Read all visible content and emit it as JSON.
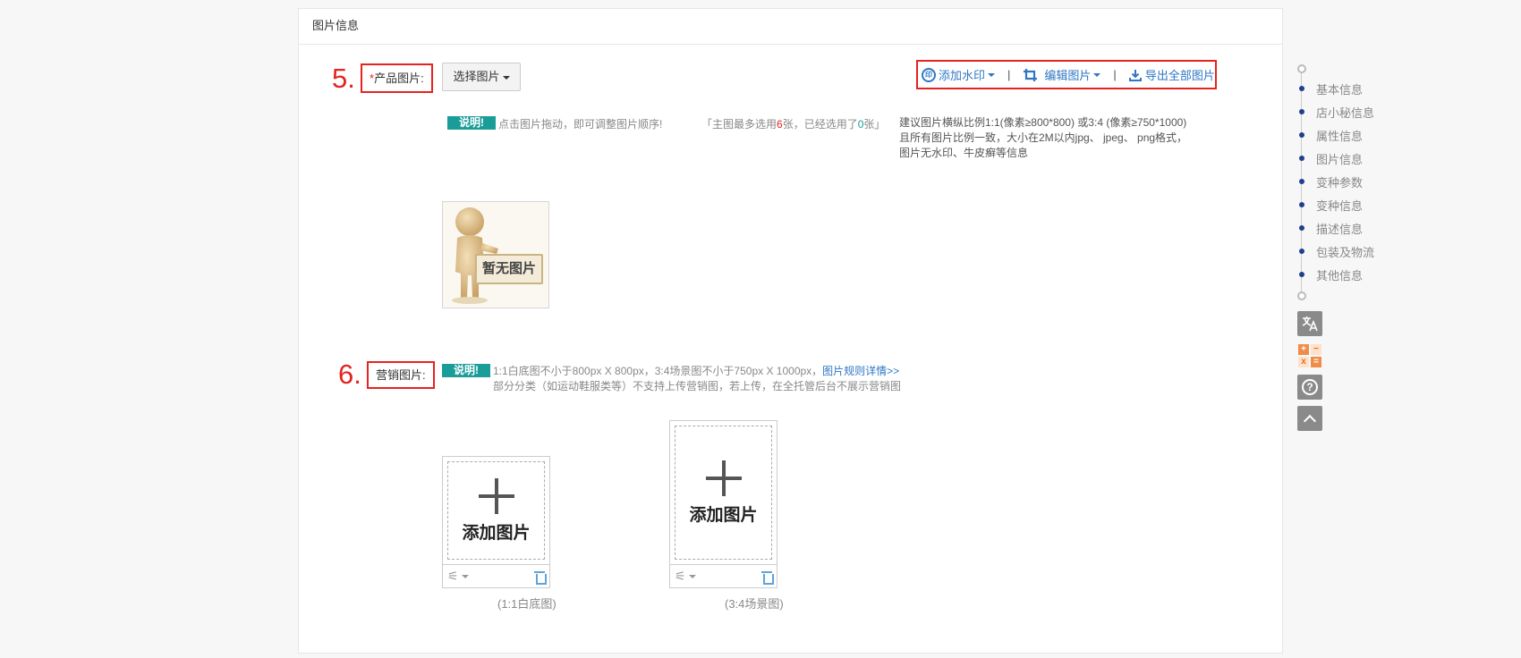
{
  "panel": {
    "title": "图片信息"
  },
  "product_images": {
    "step": "5.",
    "required_mark": "*",
    "label": "产品图片:",
    "select_button": "选择图片",
    "toolbar": {
      "watermark_icon": "印",
      "watermark": "添加水印",
      "edit": "编辑图片",
      "export": "导出全部图片",
      "separator": "|"
    },
    "note": {
      "badge": "说明!",
      "drag_hint": "点击图片拖动，即可调整图片顺序!",
      "count_prefix": "「主图最多选用",
      "max_count": "6",
      "count_middle": "张，已经选用了",
      "used_count": "0",
      "count_suffix": "张」",
      "spec_line1": "建议图片横纵比例1:1(像素≥800*800) 或3:4 (像素≥750*1000)",
      "spec_line2": "且所有图片比例一致，大小在2M以内jpg、 jpeg、 png格式，",
      "spec_line3": "图片无水印、牛皮癣等信息"
    },
    "placeholder_caption": "暂无图片"
  },
  "marketing_images": {
    "step": "6.",
    "label": "营销图片:",
    "note": {
      "badge": "说明!",
      "line1": "1:1白底图不小于800px X 800px，3:4场景图不小于750px X 1000px，",
      "rules_link": "图片规则详情>>",
      "line2": "部分分类（如运动鞋服类等）不支持上传营销图，若上传，在全托管后台不展示营销图"
    },
    "slots": [
      {
        "label": "添加图片",
        "caption": "(1:1白底图)"
      },
      {
        "label": "添加图片",
        "caption": "(3:4场景图)"
      }
    ]
  },
  "nav": {
    "items": [
      {
        "label": "基本信息"
      },
      {
        "label": "店小秘信息"
      },
      {
        "label": "属性信息"
      },
      {
        "label": "图片信息"
      },
      {
        "label": "变种参数"
      },
      {
        "label": "变种信息"
      },
      {
        "label": "描述信息"
      },
      {
        "label": "包装及物流"
      },
      {
        "label": "其他信息"
      }
    ]
  },
  "side_tools": {
    "calc_symbols": [
      "+",
      "−",
      "x",
      "="
    ],
    "help_symbol": "?"
  },
  "icons": [
    "watermark-icon",
    "crop-icon",
    "download-icon",
    "magic-wand-icon",
    "trash-icon",
    "translate-icon",
    "calculator-icon",
    "help-icon",
    "back-to-top-icon"
  ]
}
